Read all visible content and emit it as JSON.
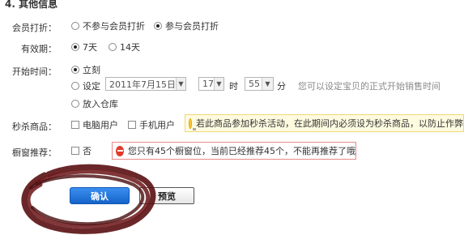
{
  "section_title": "4. 其他信息",
  "discount": {
    "label": "会员打折：",
    "options": [
      {
        "label": "不参与会员打折",
        "selected": false
      },
      {
        "label": "参与会员打折",
        "selected": true
      }
    ]
  },
  "validity": {
    "label": "有效期：",
    "options": [
      {
        "label": "7天",
        "selected": true
      },
      {
        "label": "14天",
        "selected": false
      }
    ]
  },
  "start_time": {
    "label": "开始时间：",
    "immediate_label": "立刻",
    "set_label": "设定",
    "date_value": "2011年7月15日",
    "hour_value": "17",
    "hour_unit": "时",
    "minute_value": "55",
    "minute_unit": "分",
    "hint": "您可以设定宝贝的正式开始销售时间",
    "warehouse_label": "放入仓库",
    "selected": "immediate"
  },
  "flash_sale": {
    "label": "秒杀商品：",
    "options": [
      {
        "label": "电脑用户",
        "checked": false
      },
      {
        "label": "手机用户",
        "checked": false
      }
    ],
    "tip": "若此商品参加秒杀活动，在此期间内必须设为秒杀商品，以防止作弊"
  },
  "showcase": {
    "label": "橱窗推荐：",
    "option_label": "否",
    "checked": false,
    "warning": "您只有45个橱窗位，当前已经推荐45个，不能再推荐了哦"
  },
  "buttons": {
    "confirm": "确认",
    "preview": "预览"
  },
  "colors": {
    "primary_button": "#1663c9",
    "scribble": "#5a0f12",
    "tip_background": "#fffbe0",
    "warning_border": "#e98a8a"
  }
}
